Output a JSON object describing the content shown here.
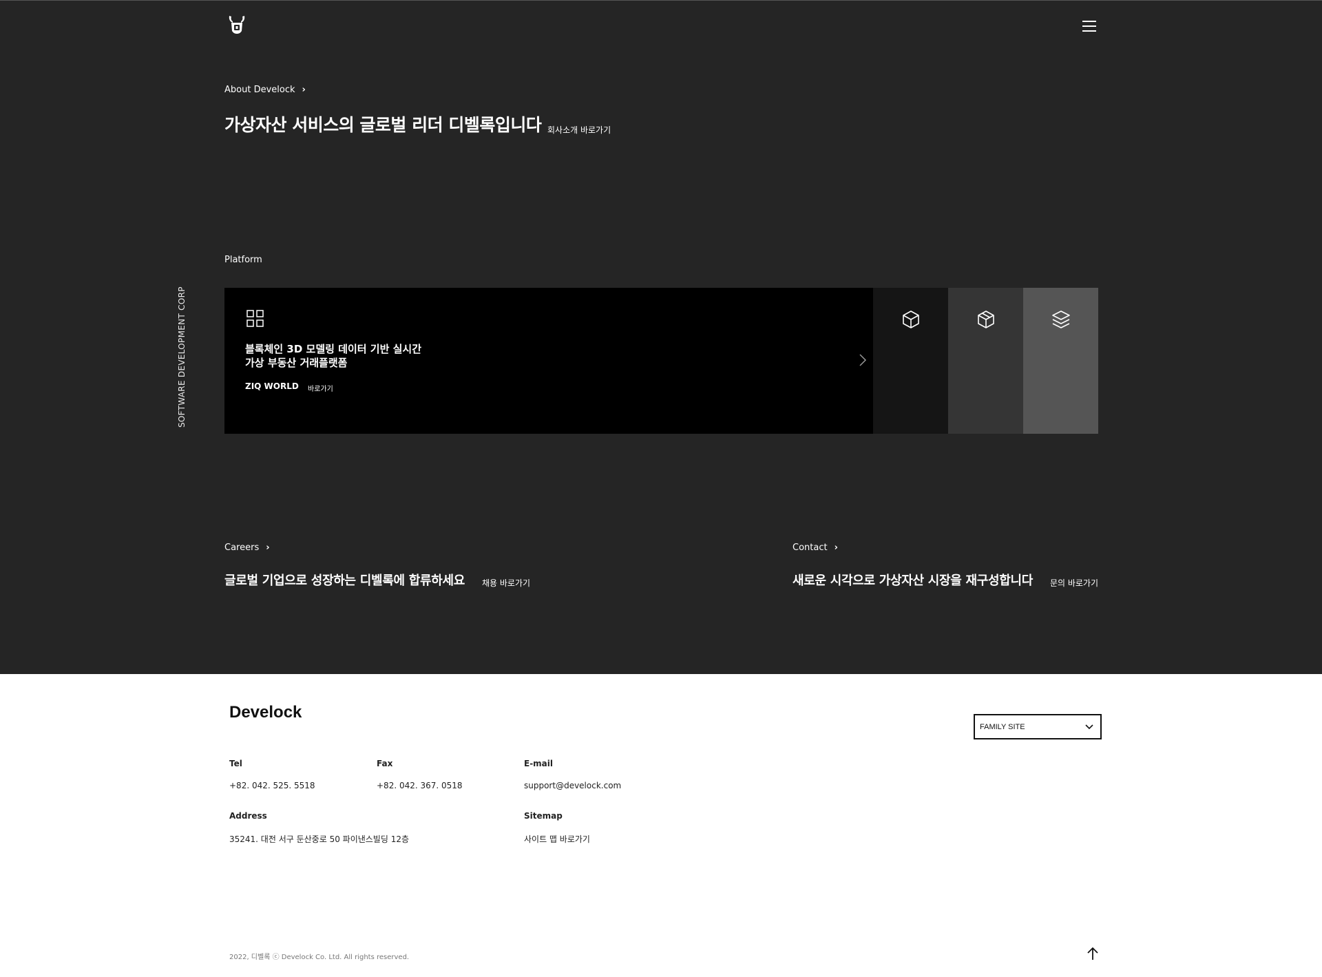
{
  "header": {
    "logo": "develock-bull-logo",
    "menu_icon": "hamburger-menu-icon"
  },
  "side_label": "SOFTWARE DEVELOPMENT CORP",
  "about": {
    "label": "About Develock",
    "headline": "가상자산 서비스의 글로벌 리더 디벨록입니다",
    "link": "회사소개 바로가기"
  },
  "platform": {
    "label": "Platform",
    "main_card": {
      "icon": "grid-icon",
      "title_line1": "블록체인 3D 모델링 데이터 기반 실시간",
      "title_line2": "가상 부동산 거래플랫폼",
      "name": "ZIQ WORLD",
      "link": "바로가기"
    },
    "tabs": [
      {
        "icon": "cube-icon",
        "bg": "#151515"
      },
      {
        "icon": "package-icon",
        "bg": "#353535"
      },
      {
        "icon": "layers-icon",
        "bg": "#555555"
      }
    ]
  },
  "careers": {
    "label": "Careers",
    "headline": "글로벌 기업으로 성장하는 디벨록에 합류하세요",
    "link": "채용 바로가기"
  },
  "contact": {
    "label": "Contact",
    "headline": "새로운 시각으로 가상자산 시장을 재구성합니다",
    "link": "문의 바로가기"
  },
  "footer": {
    "brand": "Develock",
    "family_site": "FAMILY SITE",
    "tel_label": "Tel",
    "tel_value": "+82. 042. 525. 5518",
    "fax_label": "Fax",
    "fax_value": "+82. 042. 367. 0518",
    "email_label": "E-mail",
    "email_value": "support@develock.com",
    "address_label": "Address",
    "address_value": "35241. 대전 서구 둔산중로 50 파이낸스빌딩 12층",
    "sitemap_label": "Sitemap",
    "sitemap_value": "사이트 맵 바로가기",
    "copyright": "2022, 디벨록 ⓒ Develock Co. Ltd. All rights reserved."
  },
  "colors": {
    "dark_bg": "#252525",
    "card_bg": "#000000",
    "footer_bg": "#ffffff"
  }
}
